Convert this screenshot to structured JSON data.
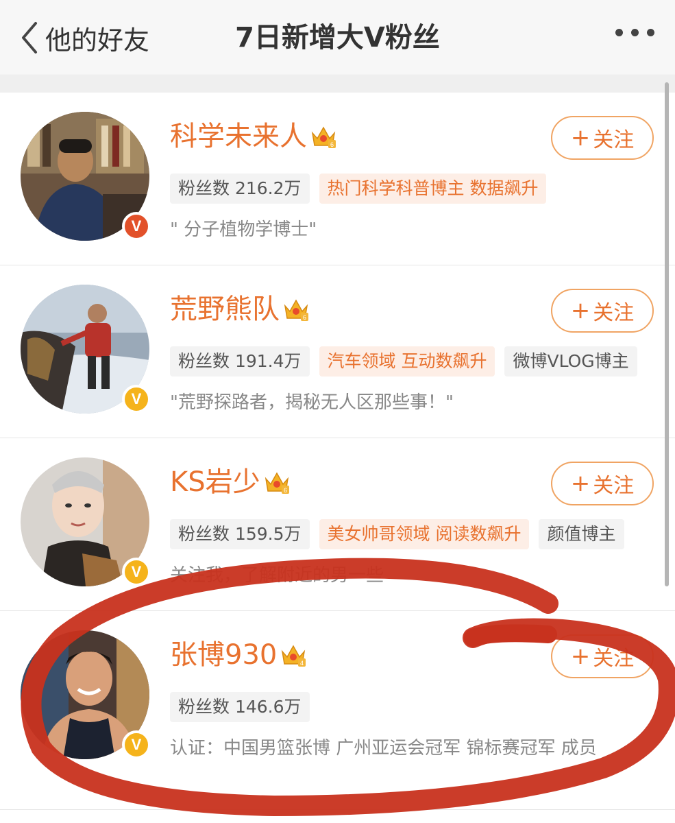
{
  "nav": {
    "back_label": "他的好友",
    "title": "7日新增大V粉丝"
  },
  "rows": [
    {
      "name": "科学未来人",
      "crown_level": "6",
      "verified_color": "#d23c2c",
      "follow_label": "关注",
      "tags": [
        {
          "text": "粉丝数 216.2万",
          "style": "gray"
        },
        {
          "text": "热门科学科普博主 数据飙升",
          "style": "orange"
        }
      ],
      "desc": "\" 分子植物学博士\""
    },
    {
      "name": "荒野熊队",
      "crown_level": "6",
      "verified_color": "#f5b31b",
      "follow_label": "关注",
      "tags": [
        {
          "text": "粉丝数 191.4万",
          "style": "gray"
        },
        {
          "text": "汽车领域 互动数飙升",
          "style": "orange"
        },
        {
          "text": "微博VLOG博主",
          "style": "gray"
        }
      ],
      "desc": "\"荒野探路者，揭秘无人区那些事！\""
    },
    {
      "name": "KS岩少",
      "crown_level": "6",
      "verified_color": "#f5b31b",
      "follow_label": "关注",
      "tags": [
        {
          "text": "粉丝数 159.5万",
          "style": "gray"
        },
        {
          "text": "美女帅哥领域 阅读数飙升",
          "style": "orange"
        },
        {
          "text": "颜值博主",
          "style": "gray"
        }
      ],
      "desc": "关注我，了解附近的男一些"
    },
    {
      "name": "张博930",
      "crown_level": "4",
      "verified_color": "#f5b31b",
      "follow_label": "关注",
      "tags": [
        {
          "text": "粉丝数 146.6万",
          "style": "gray"
        }
      ],
      "desc": "认证：中国男篮张博 广州亚运会冠军 锦标赛冠军 成员"
    }
  ],
  "colors": {
    "accent": "#e8722f",
    "annotation": "#c8321e"
  }
}
